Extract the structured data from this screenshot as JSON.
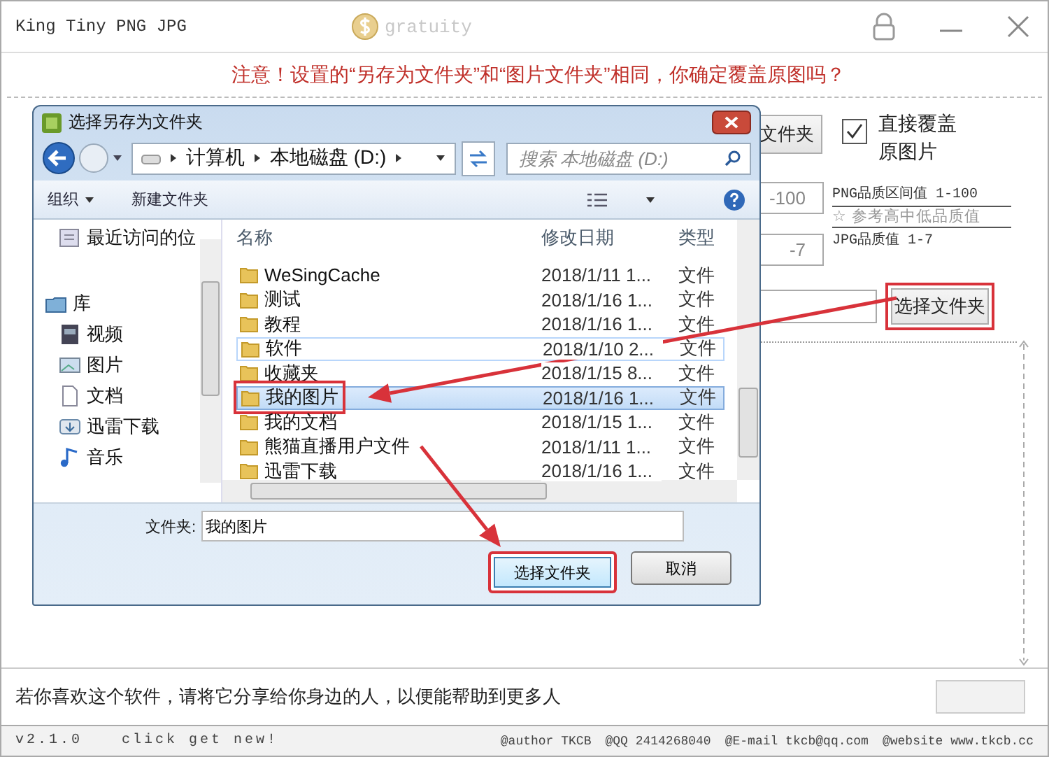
{
  "window": {
    "title": "King Tiny PNG JPG",
    "gratuity": "gratuity"
  },
  "warning": "注意！设置的“另存为文件夹”和“图片文件夹”相同，你确定覆盖原图吗？",
  "settings": {
    "save_folder_button": {
      "label": "文件夹"
    },
    "overwrite": {
      "label": "直接覆盖原图片",
      "checked": true
    },
    "png_quality": {
      "value": "-100",
      "label": "PNG品质区间值 1-100"
    },
    "hint": "☆ 参考高中低品质值",
    "jpg_quality": {
      "value": "-7",
      "label": "JPG品质值 1-7"
    },
    "image_folder_button": {
      "label": "选择文件夹",
      "highlighted": true
    }
  },
  "dialog": {
    "title": "选择另存为文件夹",
    "path": [
      "计算机",
      "本地磁盘 (D:)"
    ],
    "search": {
      "placeholder": "搜索 本地磁盘 (D:)"
    },
    "toolbar": [
      {
        "label": "组织",
        "dropdown": true
      },
      {
        "label": "新建文件夹",
        "dropdown": false
      }
    ],
    "nav": [
      {
        "label": "最近访问的位",
        "kind": "recent"
      },
      {
        "label": "库",
        "kind": "library"
      },
      {
        "label": "视频",
        "kind": "video"
      },
      {
        "label": "图片",
        "kind": "image"
      },
      {
        "label": "文档",
        "kind": "document"
      },
      {
        "label": "迅雷下载",
        "kind": "download"
      },
      {
        "label": "音乐",
        "kind": "music"
      }
    ],
    "columns": [
      "名称",
      "修改日期",
      "类型"
    ],
    "rows": [
      {
        "name": "WeSingCache",
        "date": "2018/1/11 1...",
        "type": "文件",
        "selected": false,
        "hovered": false,
        "highlighted": false
      },
      {
        "name": "测试",
        "date": "2018/1/16 1...",
        "type": "文件",
        "selected": false,
        "hovered": false,
        "highlighted": false
      },
      {
        "name": "教程",
        "date": "2018/1/16 1...",
        "type": "文件",
        "selected": false,
        "hovered": false,
        "highlighted": false
      },
      {
        "name": "软件",
        "date": "2018/1/10 2...",
        "type": "文件",
        "selected": false,
        "hovered": true,
        "highlighted": false
      },
      {
        "name": "收藏夹",
        "date": "2018/1/15 8...",
        "type": "文件",
        "selected": false,
        "hovered": false,
        "highlighted": false
      },
      {
        "name": "我的图片",
        "date": "2018/1/16 1...",
        "type": "文件",
        "selected": true,
        "hovered": false,
        "highlighted": true
      },
      {
        "name": "我的文档",
        "date": "2018/1/15 1...",
        "type": "文件",
        "selected": false,
        "hovered": false,
        "highlighted": false
      },
      {
        "name": "熊猫直播用户文件",
        "date": "2018/1/11 1...",
        "type": "文件",
        "selected": false,
        "hovered": false,
        "highlighted": false
      },
      {
        "name": "迅雷下载",
        "date": "2018/1/16 1...",
        "type": "文件",
        "selected": false,
        "hovered": false,
        "highlighted": false
      }
    ],
    "folder_field": {
      "label": "文件夹:",
      "value": "我的图片"
    },
    "buttons": [
      {
        "label": "选择文件夹",
        "default": true,
        "highlighted": true
      },
      {
        "label": "取消",
        "default": false,
        "highlighted": false
      }
    ]
  },
  "footer": {
    "share_text": "若你喜欢这个软件，请将它分享给你身边的人，以便能帮助到更多人"
  },
  "status_bar": {
    "version": "v2.1.0",
    "update_link": "click get new!",
    "author": "@author TKCB",
    "qq": "@QQ 2414268040",
    "email": "@E-mail tkcb@qq.com",
    "website": "@website www.tkcb.cc"
  }
}
